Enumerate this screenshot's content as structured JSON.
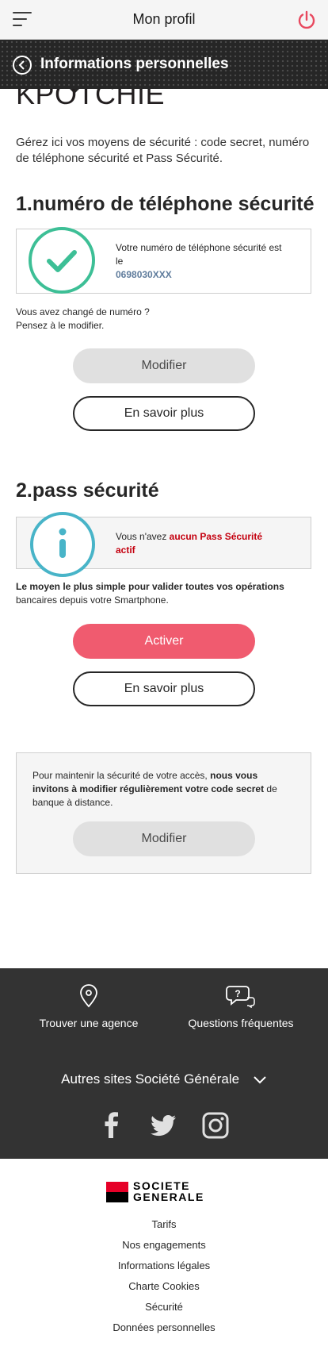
{
  "header": {
    "title": "Mon profil"
  },
  "subheader": {
    "title": "Informations personnelles"
  },
  "profile": {
    "name_partial": "KPOTCHIE"
  },
  "intro_text": "Gérez ici vos moyens de sécurité : code secret, numéro de téléphone sécurité et Pass Sécurité.",
  "phone_section": {
    "title": "1.numéro de téléphone sécurité",
    "box_text": "Votre numéro de téléphone sécurité est le",
    "phone_number": "0698030XXX",
    "changed_text": "Vous avez changé de numéro ?",
    "changed_text2": "Pensez à le modifier.",
    "modify_label": "Modifier",
    "learn_more_label": "En savoir plus"
  },
  "pass_section": {
    "title": "2.pass sécurité",
    "box_text_prefix": "Vous n'avez ",
    "box_text_highlight": "aucun Pass Sécurité actif",
    "desc_bold": "Le moyen le plus simple pour valider toutes vos opérations",
    "desc_rest": "bancaires depuis votre Smartphone.",
    "activate_label": "Activer",
    "learn_more_label": "En savoir plus"
  },
  "code_panel": {
    "text_prefix": "Pour maintenir la sécurité de votre accès, ",
    "text_bold": "nous vous invitons à modifier régulièrement votre code secret",
    "text_suffix": " de banque à distance.",
    "modify_label": "Modifier"
  },
  "footer": {
    "find_agency": "Trouver une agence",
    "faq": "Questions fréquentes",
    "other_sites": "Autres sites Société Générale",
    "brand_line1": "SOCIETE",
    "brand_line2": "GENERALE",
    "links": [
      "Tarifs",
      "Nos engagements",
      "Informations légales",
      "Charte Cookies",
      "Sécurité",
      "Données personnelles"
    ]
  },
  "colors": {
    "accent_red": "#f05b6f",
    "check_green": "#3dbf96",
    "info_blue": "#48b4c8",
    "dark": "#262626"
  }
}
